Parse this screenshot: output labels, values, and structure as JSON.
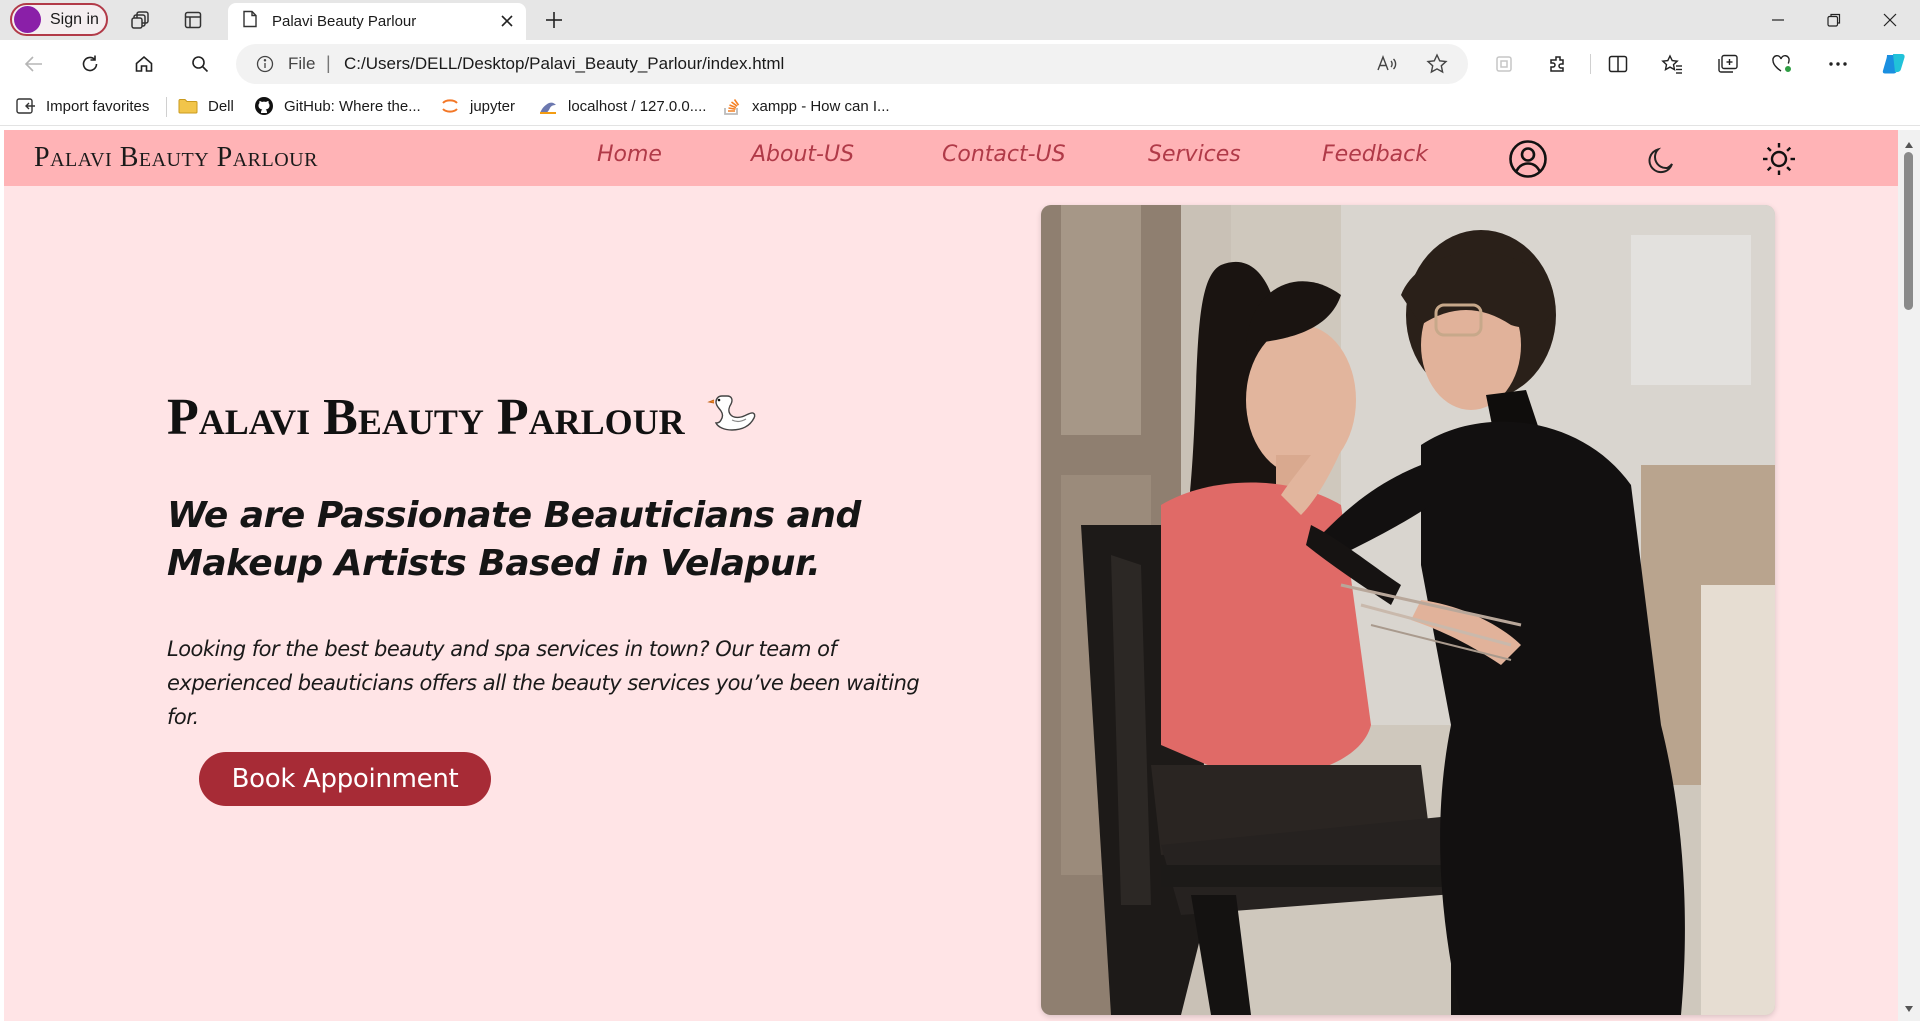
{
  "browser": {
    "signin_label": "Sign in",
    "tab_title": "Palavi Beauty Parlour",
    "address_scheme": "File",
    "address_separator": "|",
    "address_url": "C:/Users/DELL/Desktop/Palavi_Beauty_Parlour/index.html",
    "favorites": [
      {
        "label": "Import favorites",
        "icon": "import-icon"
      },
      {
        "label": "Dell",
        "icon": "folder-icon"
      },
      {
        "label": "GitHub: Where the...",
        "icon": "github-icon"
      },
      {
        "label": "jupyter",
        "icon": "jupyter-icon"
      },
      {
        "label": "localhost / 127.0.0....",
        "icon": "phpmyadmin-icon"
      },
      {
        "label": "xampp - How can I...",
        "icon": "stackoverflow-icon"
      }
    ]
  },
  "site": {
    "brand": "Palavi Beauty Parlour",
    "nav": [
      {
        "label": "Home"
      },
      {
        "label": "About-US"
      },
      {
        "label": "Contact-US"
      },
      {
        "label": "Services"
      },
      {
        "label": "Feedback"
      }
    ],
    "hero": {
      "title": "Palavi Beauty Parlour",
      "subtitle": "We are Passionate Beauticians and Makeup Artists Based in Velapur.",
      "description": "Looking for the best beauty and spa services in town? Our team of experienced beauticians offers all the beauty services you’ve been waiting for.",
      "cta": "Book Appoinment"
    }
  },
  "colors": {
    "navbar": "#ffb3b6",
    "page_bg": "#ffe4e6",
    "nav_link": "#b03a48",
    "cta_bg": "#a72b36"
  }
}
